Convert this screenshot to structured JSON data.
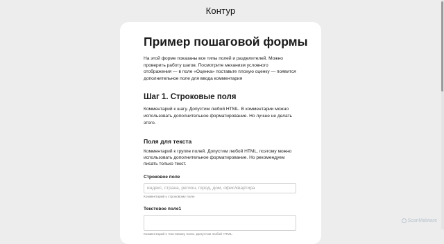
{
  "header": {
    "logo": "Контур"
  },
  "form": {
    "title": "Пример пошаговой формы",
    "intro": "На этой форме показаны все типы полей и разделителей. Можно проверить работу шагов. Посмотрите механизм условного отображения — в поле «Оценка» поставьте плохую оценку — появится дополнительное поле для ввода комментария",
    "step": {
      "title": "Шаг 1. Строковые поля",
      "description": "Комментарий к шагу. Допустим любой HTML. В комментарии можно использовать дополнительное форматирование. Но лучше не делать этого."
    },
    "group": {
      "title": "Поля для текста",
      "description": "Комментарий к группе полей. Допустим любой HTML, поэтому можно использовать дополнительное форматирование. Но рекомендуем писать только текст."
    },
    "fields": [
      {
        "label": "Строковое поле",
        "placeholder": "индекс, страна, регион, город, дом, офис/квартира",
        "value": "",
        "hint": "Комментарий к строковому полю"
      },
      {
        "label": "Текстовое поле1",
        "placeholder": "",
        "value": "",
        "hint": "Комментарий к текстовому полю. Допустим любой HTML."
      }
    ]
  },
  "watermark": "ScanMalware"
}
